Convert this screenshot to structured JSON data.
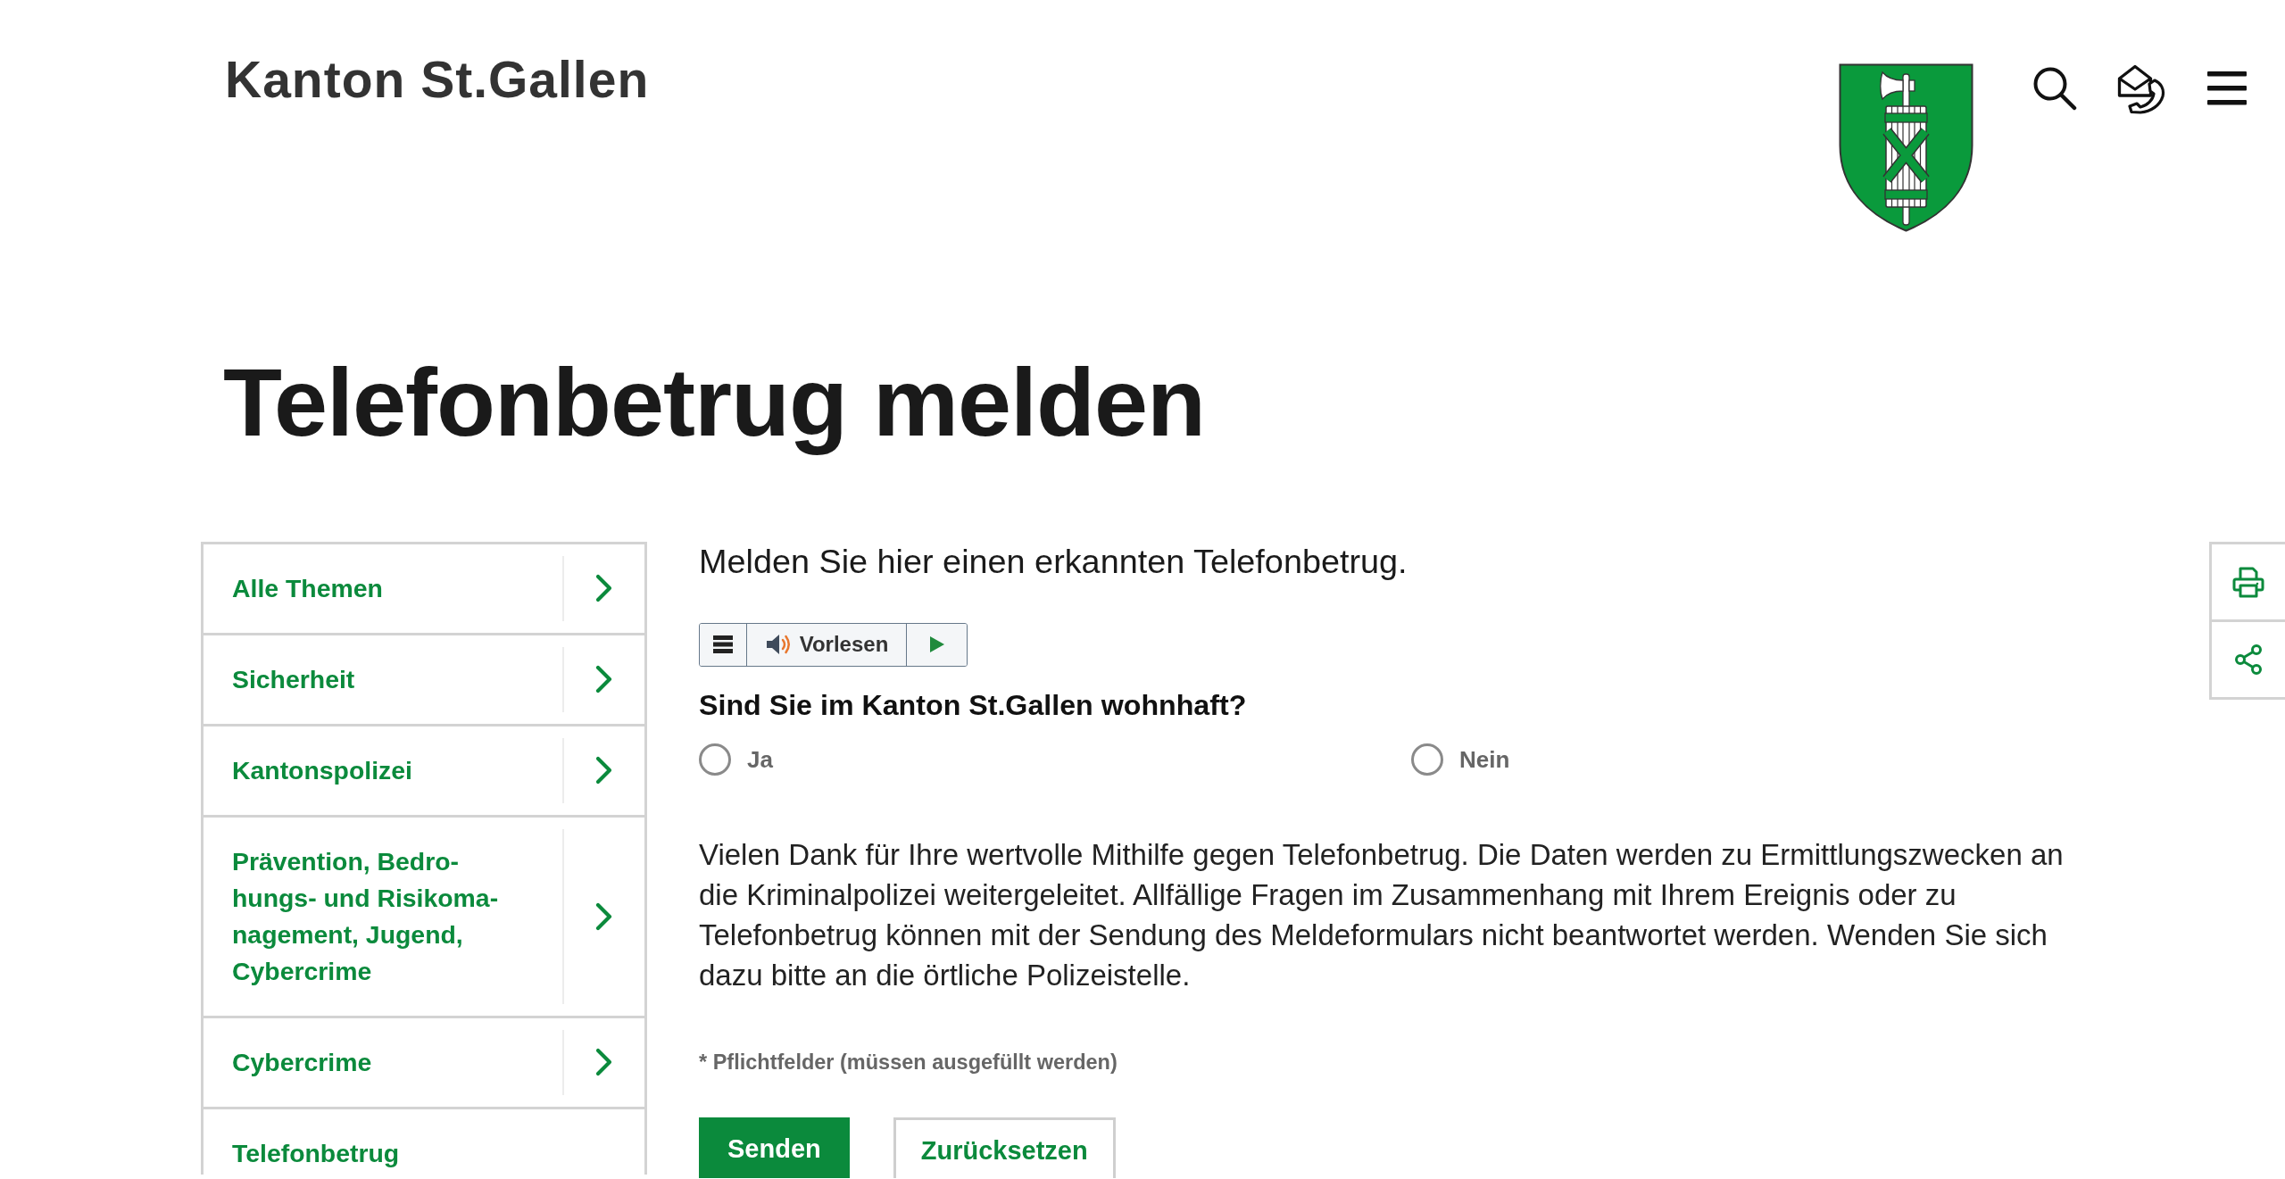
{
  "header": {
    "site_name": "Kanton St.Gallen"
  },
  "page_title": "Telefonbetrug melden",
  "sidebar": {
    "items": [
      {
        "label": "Alle Themen",
        "has_arrow": true
      },
      {
        "label": "Sicherheit",
        "has_arrow": true
      },
      {
        "label": "Kantonspolizei",
        "has_arrow": true
      },
      {
        "label": "Prävention, Bedro-hungs- und Risikoma-nagement, Jugend, Cybercrime",
        "has_arrow": true
      },
      {
        "label": "Cybercrime",
        "has_arrow": true
      },
      {
        "label": "Telefonbetrug",
        "has_arrow": false
      }
    ]
  },
  "form": {
    "intro": "Melden Sie hier einen erkannten Telefonbetrug.",
    "read_aloud": {
      "label": "Vorlesen"
    },
    "question": "Sind Sie im Kanton St.Gallen wohnhaft?",
    "options": [
      {
        "label": "Ja",
        "selected": false
      },
      {
        "label": "Nein",
        "selected": false
      }
    ],
    "notice": "Vielen Dank für Ihre wertvolle Mithilfe gegen Telefonbetrug. Die Daten werden zu Ermittlungszwecken an die Kriminalpolizei weitergeleitet. Allfällige Fragen im Zusammenhang mit Ihrem Ereignis oder zu Telefonbetrug können mit der Sendung des Meldeformulars nicht beantwortet werden. Wenden Sie sich dazu bitte an die örtliche Polizeistelle.",
    "required_note": "* Pflichtfelder (müssen ausgefüllt werden)",
    "buttons": [
      {
        "label": "Senden",
        "kind": "primary"
      },
      {
        "label": "Zurücksetzen",
        "kind": "secondary"
      }
    ]
  }
}
